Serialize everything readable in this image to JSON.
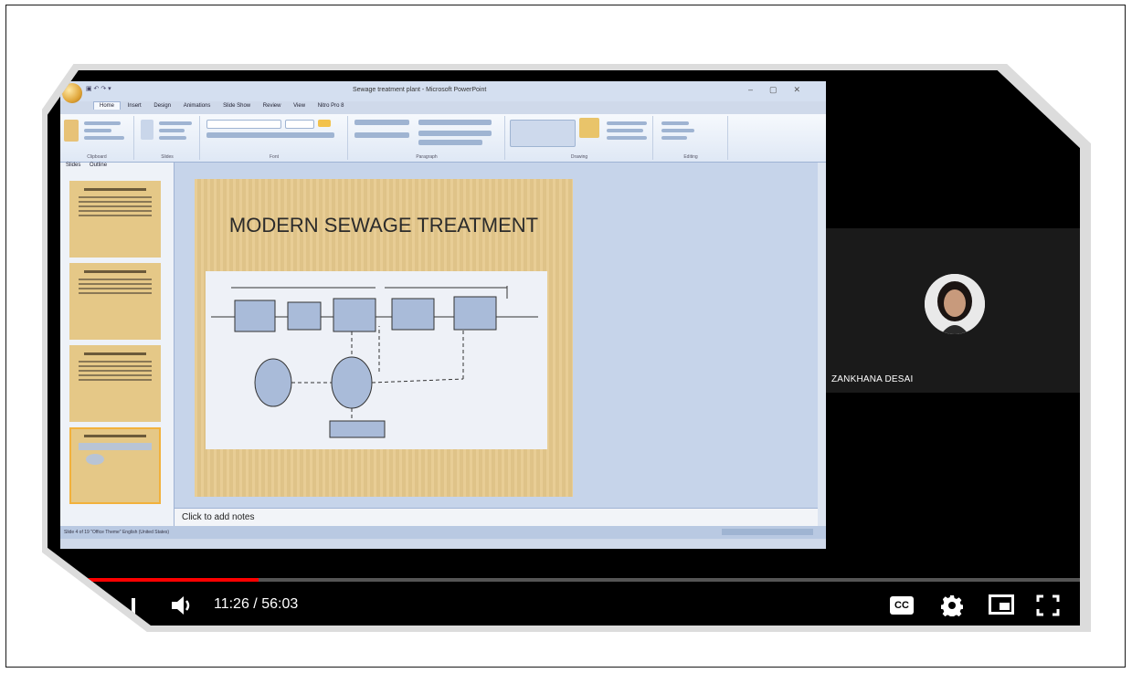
{
  "powerpoint": {
    "window_title": "Sewage treatment plant - Microsoft PowerPoint",
    "tabs": [
      "Home",
      "Insert",
      "Design",
      "Animations",
      "Slide Show",
      "Review",
      "View",
      "Nitro Pro 8"
    ],
    "ribbon_groups": [
      "Clipboard",
      "Slides",
      "Font",
      "Paragraph",
      "Drawing",
      "Editing"
    ],
    "pane_tabs": [
      "Slides",
      "Outline"
    ],
    "slide_title": "MODERN SEWAGE TREATMENT",
    "notes_placeholder": "Click to add notes",
    "status_text": "Slide 4 of 19   \"Office Theme\"   English (United States)"
  },
  "participant": {
    "name": "ZANKHANA DESAI"
  },
  "player": {
    "current_time": "11:26",
    "separator": " / ",
    "duration": "56:03",
    "progress_fraction": 0.204,
    "accent_color": "#ff0000"
  },
  "controls": {
    "captions_label": "CC"
  }
}
